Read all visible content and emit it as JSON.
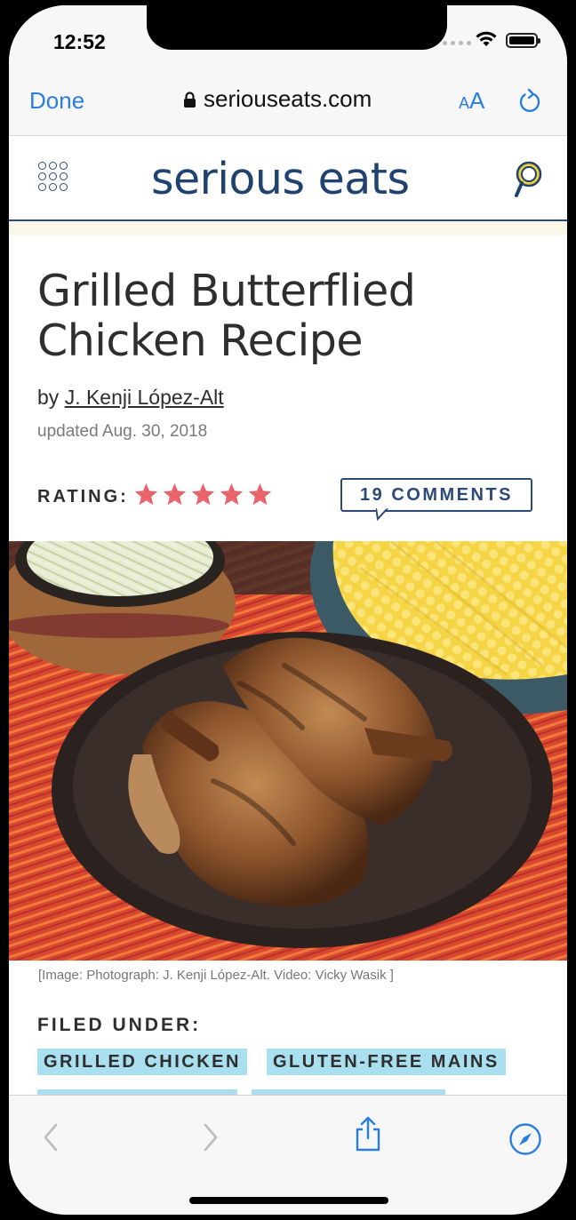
{
  "status_bar": {
    "time": "12:52"
  },
  "safari": {
    "done_label": "Done",
    "url": "seriouseats.com",
    "text_size_small": "A",
    "text_size_large": "A"
  },
  "site": {
    "logo": "serious eats"
  },
  "article": {
    "title": "Grilled Butterflied Chicken Recipe",
    "by_prefix": "by",
    "author": "J. Kenji López-Alt",
    "updated": "updated Aug. 30, 2018",
    "rating_label": "RATING:",
    "rating": 5,
    "rating_max": 5,
    "comments_label": "19 COMMENTS",
    "image_caption": "[Image: Photograph: J. Kenji López-Alt. Video: Vicky Wasik ]",
    "filed_under_label": "FILED UNDER:",
    "tags": [
      "GRILLED CHICKEN",
      "GLUTEN-FREE MAINS"
    ]
  },
  "colors": {
    "safari_blue": "#2a7de1",
    "brand_navy": "#1f4271",
    "star_red": "#e8656c",
    "tag_bg": "#a9dfee"
  },
  "icons": [
    "wifi-icon",
    "battery-icon",
    "lock-icon",
    "refresh-icon",
    "grid-menu-icon",
    "search-icon",
    "star-icon",
    "back-icon",
    "forward-icon",
    "share-icon",
    "compass-icon"
  ]
}
